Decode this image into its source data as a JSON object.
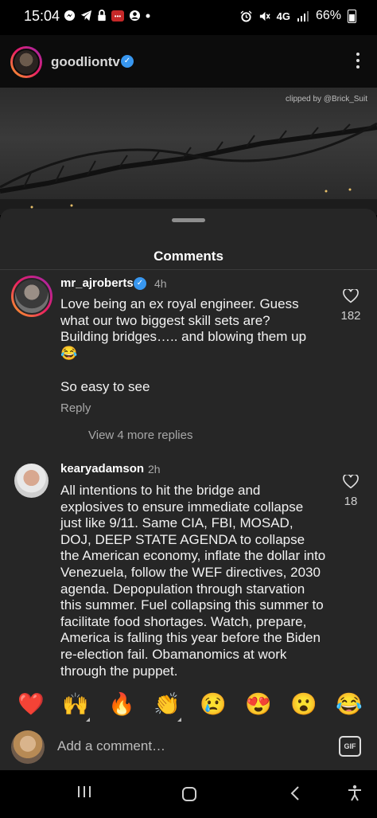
{
  "status_bar": {
    "time": "15:04",
    "battery": "66%",
    "network": "4G",
    "left_icons": [
      "messenger-icon",
      "telegram-icon",
      "lock-icon",
      "app-icon",
      "account-icon",
      "dot-icon"
    ],
    "right_icons": [
      "alarm-icon",
      "mute-icon",
      "signal-icon",
      "battery-icon"
    ]
  },
  "post_header": {
    "username": "goodliontv",
    "verified": true
  },
  "video": {
    "watermark": "clipped by @Brick_Suit"
  },
  "comments_sheet": {
    "title": "Comments",
    "comments": [
      {
        "username": "mr_ajroberts",
        "verified": true,
        "time": "4h",
        "text": "Love being an ex royal engineer. Guess what our two biggest skill sets are? Building bridges….. and blowing them up 😂",
        "text2": "So easy to see",
        "reply_label": "Reply",
        "likes": "182",
        "view_more": "View 4 more replies"
      },
      {
        "username": "kearyadamson",
        "verified": false,
        "time": "2h",
        "text": "All intentions to hit the bridge and explosives to ensure immediate collapse just like 9/11. Same CIA, FBI, MOSAD, DOJ,  DEEP STATE AGENDA to collapse the American economy, inflate the dollar into Venezuela, follow the WEF directives, 2030 agenda. Depopulation through starvation this summer. Fuel collapsing this summer to facilitate food shortages. Watch, prepare, America is falling this year before the Biden re-election fail. Obamanomics at work through the puppet.",
        "likes": "18"
      }
    ]
  },
  "emoji_bar": [
    "❤️",
    "🙌",
    "🔥",
    "👏",
    "😢",
    "😍",
    "😮",
    "😂"
  ],
  "comment_input": {
    "placeholder": "Add a comment…",
    "gif_label": "GIF"
  },
  "nav_bar": [
    "recents-icon",
    "home-icon",
    "back-icon",
    "accessibility-icon"
  ],
  "colors": {
    "sheet_bg": "#262626",
    "verified_blue": "#3897f0",
    "muted_text": "#a8a8a8"
  }
}
